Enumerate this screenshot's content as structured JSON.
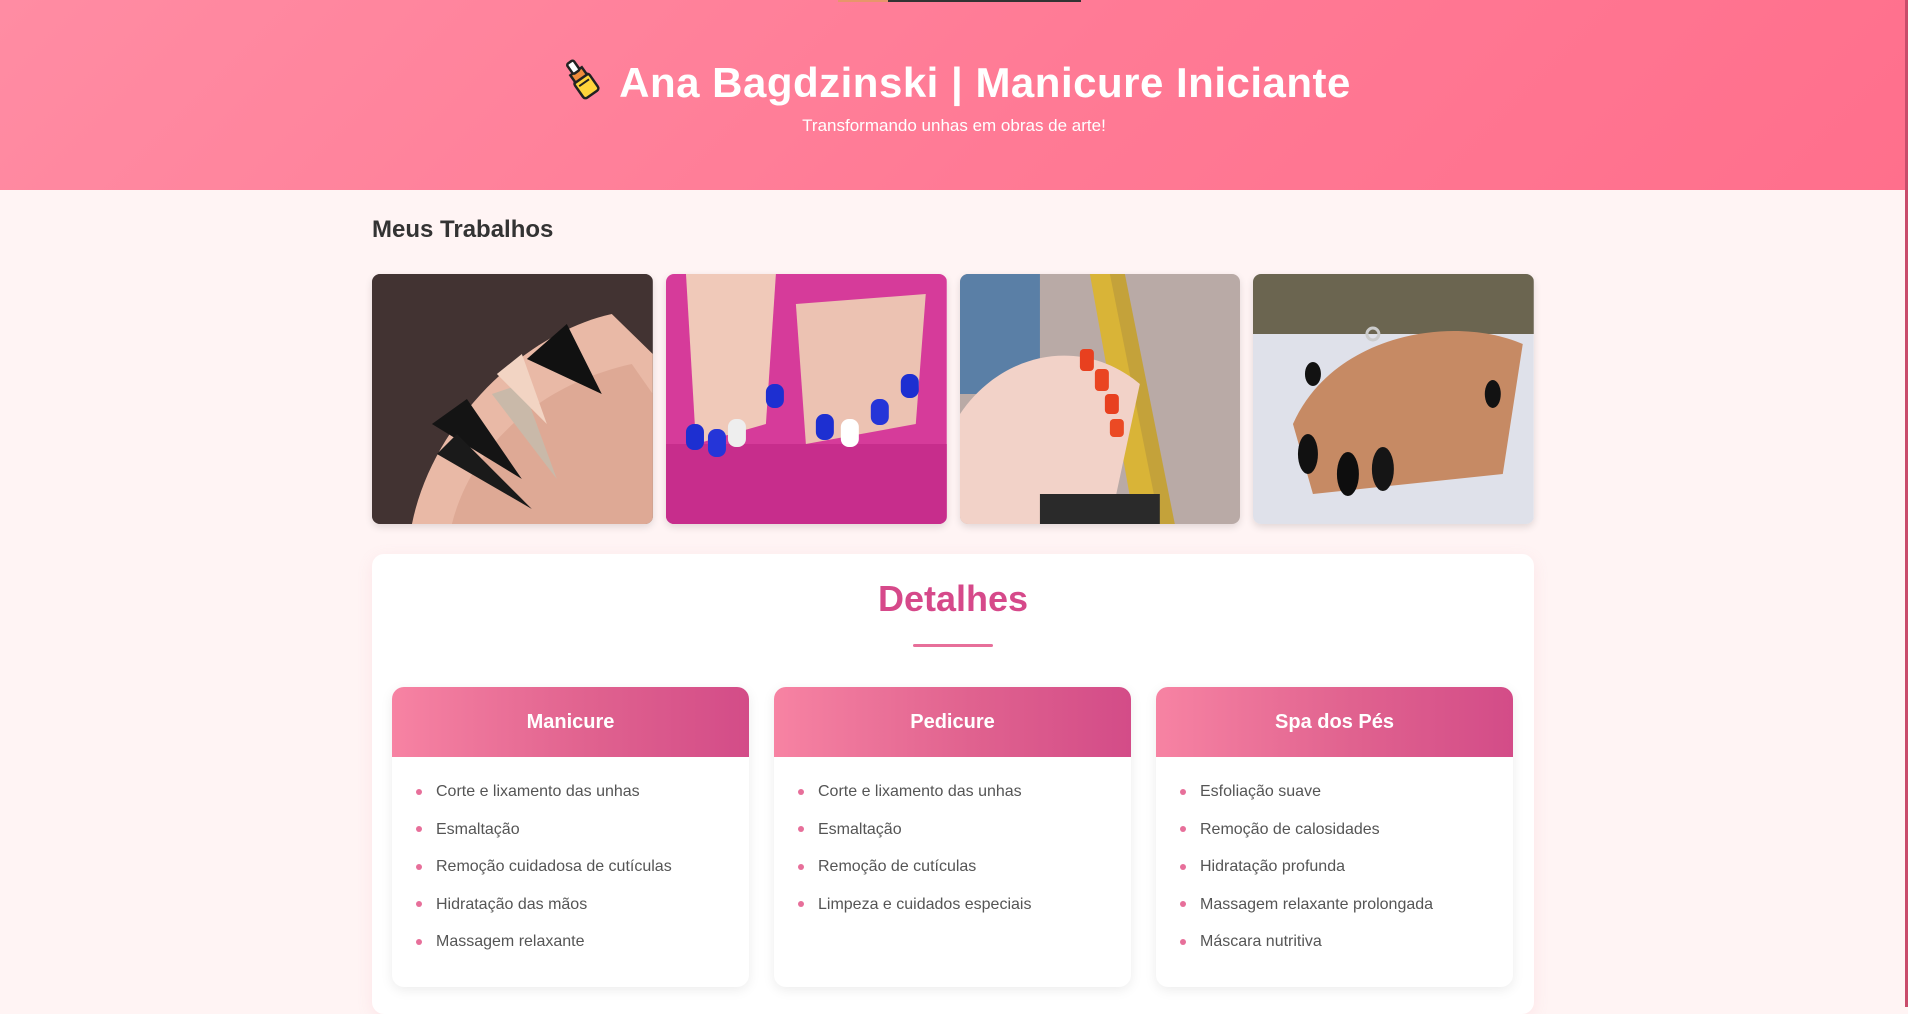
{
  "header": {
    "title": "Ana Bagdzinski | Manicure Iniciante",
    "subtitle": "Transformando unhas em obras de arte!",
    "icon": "nail-polish-icon",
    "gradient_colors": [
      "#ff8ca3",
      "#ff6f8c"
    ]
  },
  "gallery": {
    "heading": "Meus Trabalhos",
    "photos": [
      {
        "name": "photo-black-stiletto-nails",
        "description_hint": "black and glitter stiletto nails"
      },
      {
        "name": "photo-blue-nails",
        "description_hint": "blue nails with white accent nails on pink towel"
      },
      {
        "name": "photo-orange-nails",
        "description_hint": "orange nails over jeans background"
      },
      {
        "name": "photo-black-almond-nails",
        "description_hint": "black almond nails on white fluffy fabric"
      }
    ]
  },
  "details": {
    "title": "Detalhes",
    "services": [
      {
        "title": "Manicure",
        "items": [
          "Corte e lixamento das unhas",
          "Esmaltação",
          "Remoção cuidadosa de cutículas",
          "Hidratação das mãos",
          "Massagem relaxante"
        ]
      },
      {
        "title": "Pedicure",
        "items": [
          "Corte e lixamento das unhas",
          "Esmaltação",
          "Remoção de cutículas",
          "Limpeza e cuidados especiais"
        ]
      },
      {
        "title": "Spa dos Pés",
        "items": [
          "Esfoliação suave",
          "Remoção de calosidades",
          "Hidratação profunda",
          "Massagem relaxante prolongada",
          "Máscara nutritiva"
        ]
      }
    ]
  },
  "colors": {
    "accent": "#d6498a",
    "page_background": "#fff4f4",
    "bullet": "#e76f9a"
  }
}
